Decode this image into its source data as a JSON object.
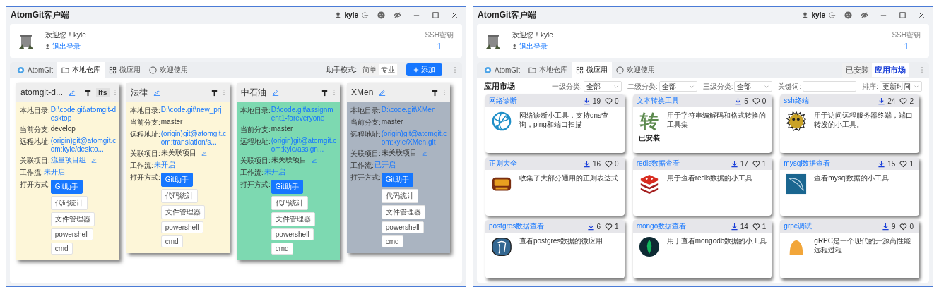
{
  "windows": [
    {
      "kind": "repos",
      "title": "AtomGit客户端",
      "username": "kyle",
      "greeting": "欢迎您！kyle",
      "logout": "退出登录",
      "ssh_label": "SSH密钥",
      "ssh_count": "1",
      "tabs": [
        {
          "label": "AtomGit",
          "selected": false
        },
        {
          "label": "本地仓库",
          "selected": true
        },
        {
          "label": "微应用",
          "selected": false
        },
        {
          "label": "欢迎使用",
          "selected": false
        }
      ],
      "mode_label": "助手模式:",
      "modes": [
        {
          "label": "简单",
          "selected": false
        },
        {
          "label": "专业",
          "selected": true
        }
      ],
      "add_button": "添加",
      "repos": [
        {
          "name": "atomgit-d...",
          "lfs": "lfs",
          "color": "#fdf6d8",
          "open_label": "打开方式:",
          "fields": [
            {
              "label": "本地目录:",
              "value": "D:\\code.git\\atomgit-desktop",
              "link": true,
              "editable": false
            },
            {
              "label": "当前分支:",
              "value": "develop",
              "link": false,
              "editable": false
            },
            {
              "label": "远程地址:",
              "value": "(origin)git@atomgit.com:kyle/deskto...",
              "link": true,
              "editable": false
            },
            {
              "label": "关联项目:",
              "value": "流量项目组",
              "link": true,
              "editable": true
            },
            {
              "label": "工作流:",
              "value": "未开启",
              "link": true,
              "editable": false
            }
          ],
          "openers": [
            {
              "label": "Git助手",
              "selected": true
            },
            {
              "label": "代码统计",
              "selected": false
            },
            {
              "label": "文件管理器",
              "selected": false
            },
            {
              "label": "powershell",
              "selected": false
            },
            {
              "label": "cmd",
              "selected": false
            }
          ]
        },
        {
          "name": "法律",
          "color": "#fdf6d8",
          "open_label": "打开方式:",
          "fields": [
            {
              "label": "本地目录:",
              "value": "D:\\code.git\\new_prj",
              "link": true,
              "editable": false
            },
            {
              "label": "当前分支:",
              "value": "master",
              "link": false,
              "editable": false
            },
            {
              "label": "远程地址:",
              "value": "(origin)git@atomgit.com:translation/s...",
              "link": true,
              "editable": false
            },
            {
              "label": "关联项目:",
              "value": "未关联项目",
              "link": false,
              "editable": true
            },
            {
              "label": "工作流:",
              "value": "未开启",
              "link": true,
              "editable": false
            }
          ],
          "openers": [
            {
              "label": "Git助手",
              "selected": true
            },
            {
              "label": "代码统计",
              "selected": false
            },
            {
              "label": "文件管理器",
              "selected": false
            },
            {
              "label": "powershell",
              "selected": false
            },
            {
              "label": "cmd",
              "selected": false
            }
          ]
        },
        {
          "name": "中石油",
          "color": "#7dd9b1",
          "open_label": "打开方式:",
          "fields": [
            {
              "label": "本地目录:",
              "value": "D:\\code.git\\assignment1-foreveryone",
              "link": true,
              "editable": false
            },
            {
              "label": "当前分支:",
              "value": "master",
              "link": false,
              "editable": false
            },
            {
              "label": "远程地址:",
              "value": "(origin)git@atomgit.com:kyle/assign...",
              "link": true,
              "editable": false
            },
            {
              "label": "关联项目:",
              "value": "未关联项目",
              "link": false,
              "editable": true
            },
            {
              "label": "工作流:",
              "value": "未开启",
              "link": true,
              "editable": false
            }
          ],
          "openers": [
            {
              "label": "Git助手",
              "selected": true
            },
            {
              "label": "代码统计",
              "selected": false
            },
            {
              "label": "文件管理器",
              "selected": false
            },
            {
              "label": "powershell",
              "selected": false
            },
            {
              "label": "cmd",
              "selected": false
            }
          ]
        },
        {
          "name": "XMen",
          "color": "#aab4c1",
          "open_label": "打开方式:",
          "fields": [
            {
              "label": "本地目录:",
              "value": "D:\\code.git\\XMen",
              "link": true,
              "editable": false
            },
            {
              "label": "当前分支:",
              "value": "master",
              "link": false,
              "editable": false
            },
            {
              "label": "远程地址:",
              "value": "(origin)git@atomgit.com:kyle/XMen.git",
              "link": true,
              "editable": false
            },
            {
              "label": "关联项目:",
              "value": "未关联项目",
              "link": false,
              "editable": true
            },
            {
              "label": "工作流:",
              "value": "已开启",
              "link": true,
              "editable": false
            }
          ],
          "openers": [
            {
              "label": "Git助手",
              "selected": true
            },
            {
              "label": "代码统计",
              "selected": false
            },
            {
              "label": "文件管理器",
              "selected": false
            },
            {
              "label": "powershell",
              "selected": false
            },
            {
              "label": "cmd",
              "selected": false
            }
          ]
        }
      ]
    },
    {
      "kind": "market",
      "title": "AtomGit客户端",
      "username": "kyle",
      "greeting": "欢迎您！kyle",
      "logout": "退出登录",
      "ssh_label": "SSH密钥",
      "ssh_count": "1",
      "tabs": [
        {
          "label": "AtomGit",
          "selected": false
        },
        {
          "label": "本地仓库",
          "selected": false
        },
        {
          "label": "微应用",
          "selected": true
        },
        {
          "label": "欢迎使用",
          "selected": false
        }
      ],
      "views": [
        {
          "label": "已安装",
          "selected": false
        },
        {
          "label": "应用市场",
          "selected": true
        }
      ],
      "market_title": "应用市场",
      "filters": [
        {
          "label": "一级分类:",
          "kind": "select",
          "value": "全部"
        },
        {
          "label": "二级分类:",
          "kind": "select",
          "value": "全部"
        },
        {
          "label": "三级分类:",
          "kind": "select",
          "value": "全部"
        },
        {
          "label": "关键词:",
          "kind": "input"
        },
        {
          "label": "排序:",
          "kind": "select",
          "value": "更新时间"
        }
      ],
      "apps": [
        {
          "name": "网络诊断",
          "downloads": "19",
          "likes": "0",
          "description": "网络诊断小工具，支持dns查询，ping和端口扫描"
        },
        {
          "name": "文本转换工具",
          "downloads": "5",
          "likes": "0",
          "description": "用于字符串编解码和格式转换的工具集",
          "logo_text": "转",
          "status": "已安装"
        },
        {
          "name": "ssh终端",
          "downloads": "24",
          "likes": "2",
          "description": "用于访问远程服务器终端，端口转发的小工具。"
        },
        {
          "name": "正则大全",
          "downloads": "16",
          "likes": "0",
          "description": "收集了大部分通用的正则表达式"
        },
        {
          "name": "redis数据查看",
          "downloads": "17",
          "likes": "1",
          "description": "用于查看redis数据的小工具"
        },
        {
          "name": "mysql数据查看",
          "downloads": "15",
          "likes": "1",
          "description": "查看mysql数据的小工具"
        },
        {
          "name": "postgres数据查看",
          "downloads": "6",
          "likes": "1",
          "description": "查看postgres数据的微应用"
        },
        {
          "name": "mongo数据查看",
          "downloads": "14",
          "likes": "1",
          "description": "用于查看mongodb数据的小工具"
        },
        {
          "name": "grpc调试",
          "downloads": "9",
          "likes": "0",
          "description": "gRPC是一个现代的开源高性能远程过程"
        }
      ]
    }
  ]
}
